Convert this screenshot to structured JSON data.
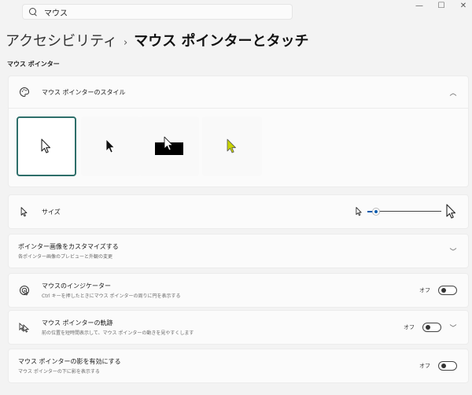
{
  "search": {
    "value": "マウス"
  },
  "window_controls": {
    "minimize": "—",
    "maximize": "☐",
    "close": "✕"
  },
  "breadcrumb": {
    "parent": "アクセシビリティ",
    "separator": "›",
    "current": "マウス ポインターとタッチ"
  },
  "section_title": "マウス ポインター",
  "pointer_style": {
    "title": "マウス ポインターのスタイル",
    "expanded": true,
    "options": [
      "white",
      "black",
      "inverted",
      "custom"
    ],
    "selected_index": 0,
    "custom_color": "#c8d400"
  },
  "size": {
    "label": "サイズ",
    "level": 0.12
  },
  "customize": {
    "title": "ポインター画像をカスタマイズする",
    "subtitle": "各ポインター画像のプレビューと外観の変更"
  },
  "indicator": {
    "title": "マウスのインジケーター",
    "subtitle": "Ctrl キーを押したときにマウス ポインターの周りに円を表示する",
    "toggle_label": "オフ",
    "on": false
  },
  "trails": {
    "title": "マウス ポインターの軌跡",
    "subtitle": "前の位置を短時間表示して、マウス ポインターの動きを見やすくします",
    "toggle_label": "オフ",
    "on": false
  },
  "shadow": {
    "title": "マウス ポインターの影を有効にする",
    "subtitle": "マウス ポインターの下に影を表示する",
    "toggle_label": "オフ",
    "on": false
  },
  "colors": {
    "accent": "#0b5cad",
    "selected_border": "#2e6f6a"
  }
}
